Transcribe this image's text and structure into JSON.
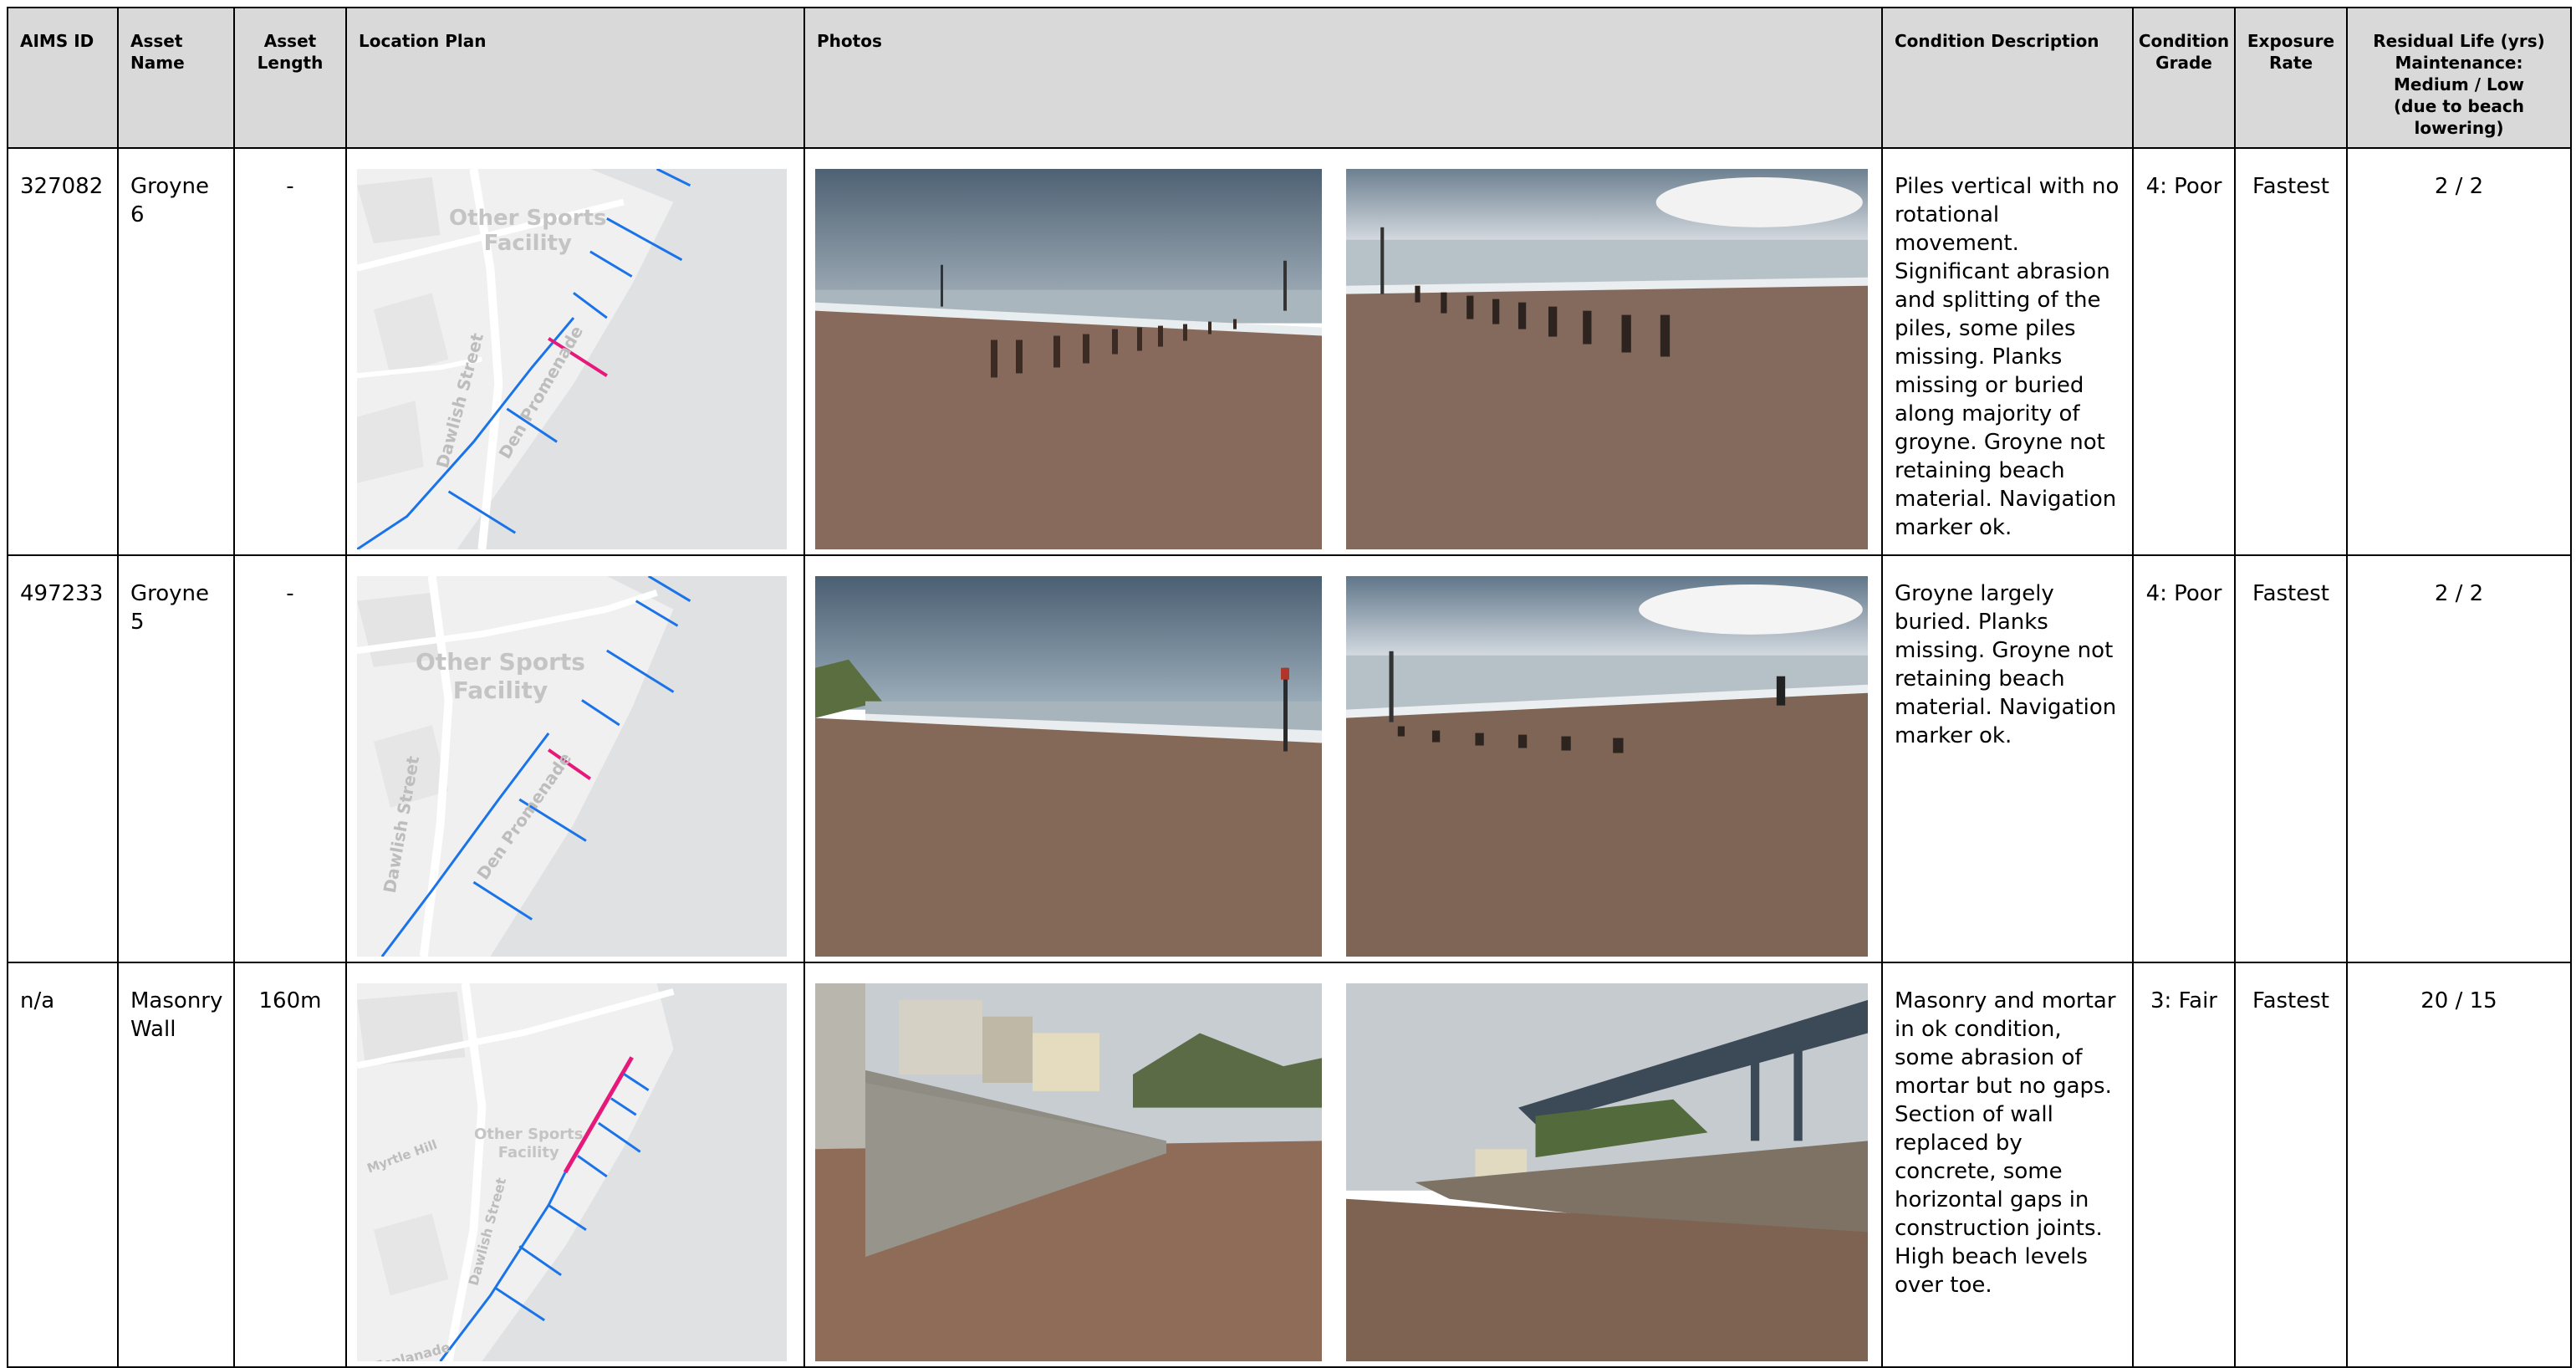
{
  "header": {
    "aims_id": "AIMS ID",
    "asset_name": "Asset Name",
    "asset_length": "Asset\nLength",
    "location_plan": "Location Plan",
    "photos": "Photos",
    "condition_description": "Condition Description",
    "condition_grade": "Condition\nGrade",
    "exposure_rate": "Exposure\nRate",
    "residual_life": "Residual Life (yrs)\nMaintenance:\nMedium / Low\n(due to beach lowering)"
  },
  "map_labels": {
    "facility": "Other Sports\nFacility",
    "dawlish_street": "Dawlish Street",
    "den_promenade": "Den Promenade",
    "esplanade": "Esplanade",
    "myrtle_hill": "Myrtle Hill"
  },
  "rows": [
    {
      "aims_id": "327082",
      "asset_name": "Groyne 6",
      "asset_length": "-",
      "condition_description": "Piles vertical with no rotational movement. Significant abrasion and splitting of the piles, some piles missing. Planks missing or buried along majority of groyne. Groyne not retaining beach material. Navigation marker ok.",
      "condition_grade": "4: Poor",
      "exposure_rate": "Fastest",
      "residual_life": "2 / 2"
    },
    {
      "aims_id": "497233",
      "asset_name": "Groyne 5",
      "asset_length": "-",
      "condition_description": "Groyne largely buried. Planks missing. Groyne not retaining beach material. Navigation marker ok.",
      "condition_grade": "4: Poor",
      "exposure_rate": "Fastest",
      "residual_life": "2 / 2"
    },
    {
      "aims_id": "n/a",
      "asset_name": "Masonry\nWall",
      "asset_length": "160m",
      "condition_description": "Masonry and mortar in ok condition, some abrasion of mortar but no gaps. Section of wall replaced by concrete, some horizontal gaps in construction joints. High beach levels over toe.",
      "condition_grade": "3: Fair",
      "exposure_rate": "Fastest",
      "residual_life": "20 / 15"
    }
  ],
  "colors": {
    "header_bg": "#d9d9d9",
    "asset_line": "#1a73e8",
    "highlight": "#e6197a",
    "sea": "#dfe1e2",
    "land": "#f0f0f0"
  }
}
